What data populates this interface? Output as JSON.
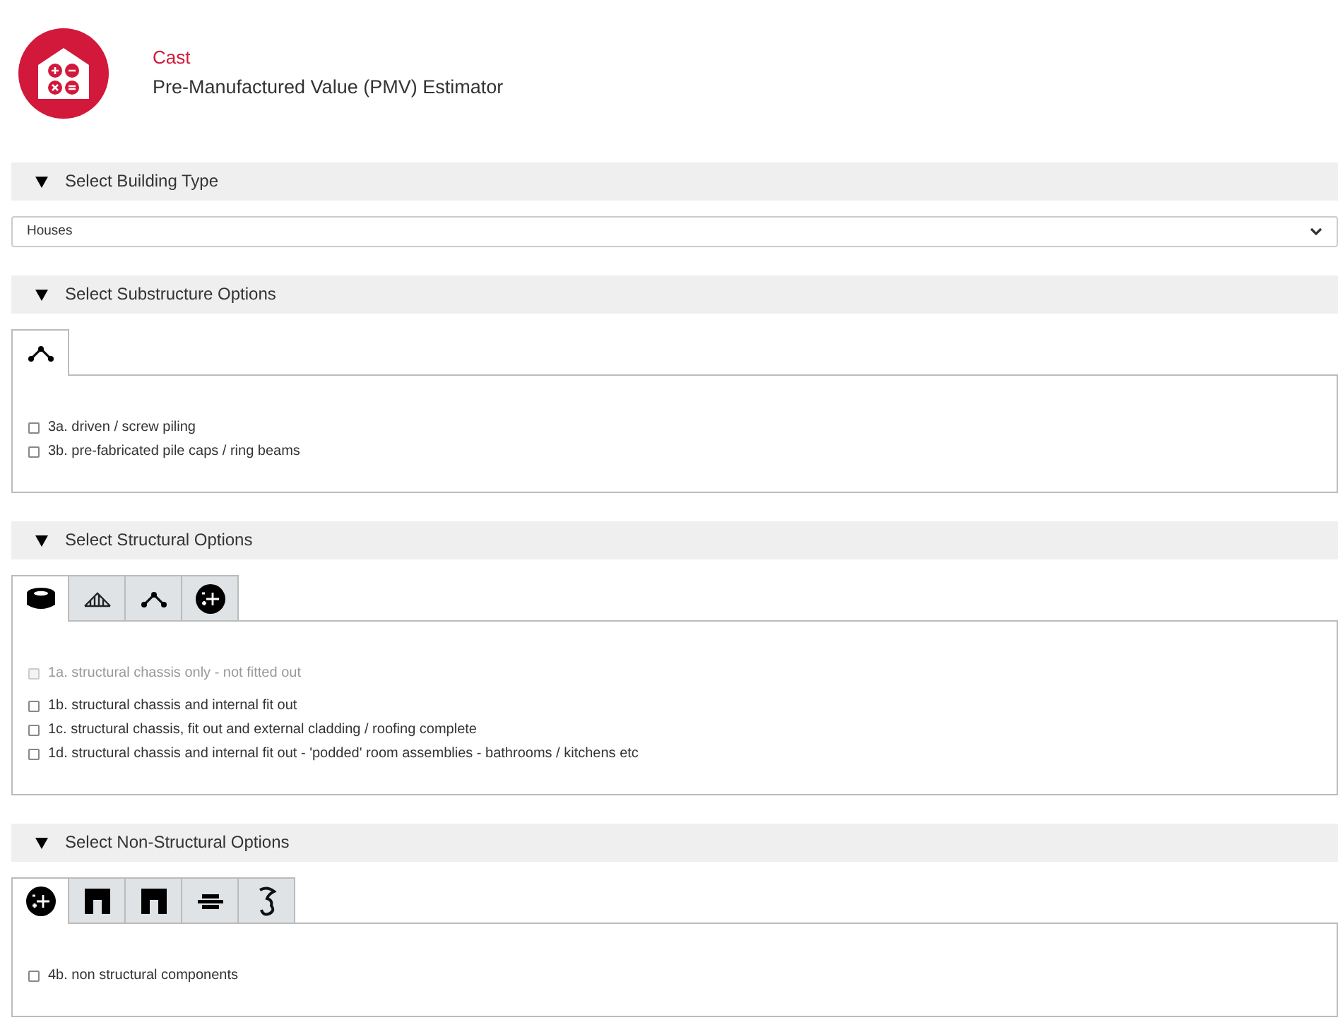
{
  "header": {
    "title": "Cast",
    "subtitle": "Pre-Manufactured Value (PMV) Estimator"
  },
  "sections": [
    {
      "kind": "select",
      "title": "Select Building Type",
      "expanded": true,
      "value": "Houses"
    },
    {
      "kind": "options",
      "title": "Select Substructure Options",
      "expanded": true,
      "tabs": [
        {
          "kind": "nodes",
          "selected": true
        }
      ],
      "options": [
        {
          "label": "3a. driven / screw piling",
          "checked": false,
          "disabled": false
        },
        {
          "label": "3b. pre-fabricated pile caps / ring beams",
          "checked": false,
          "disabled": false
        }
      ]
    },
    {
      "kind": "options",
      "title": "Select Structural Options",
      "expanded": true,
      "tabs": [
        {
          "kind": "layers",
          "selected": true
        },
        {
          "kind": "trusses",
          "selected": false
        },
        {
          "kind": "nodes",
          "selected": false
        },
        {
          "kind": "plus-circle",
          "selected": false
        }
      ],
      "options": [
        {
          "label": "1a. structural chassis only - not fitted out",
          "checked": false,
          "disabled": true
        },
        {
          "label": "1b. structural chassis and internal fit out",
          "checked": false,
          "disabled": false
        },
        {
          "label": "1c. structural chassis, fit out and external cladding / roofing complete",
          "checked": false,
          "disabled": false
        },
        {
          "label": "1d. structural chassis and internal fit out - 'podded' room assemblies - bathrooms / kitchens etc",
          "checked": false,
          "disabled": false
        }
      ]
    },
    {
      "kind": "options",
      "title": "Select Non-Structural Options",
      "expanded": true,
      "tabs": [
        {
          "kind": "plus-circle",
          "selected": true
        },
        {
          "kind": "arch",
          "selected": false
        },
        {
          "kind": "arch",
          "selected": false
        },
        {
          "kind": "bricks",
          "selected": false
        },
        {
          "kind": "hook",
          "selected": false
        }
      ],
      "options": [
        {
          "label": "4b. non structural components",
          "checked": false,
          "disabled": false
        }
      ]
    }
  ]
}
